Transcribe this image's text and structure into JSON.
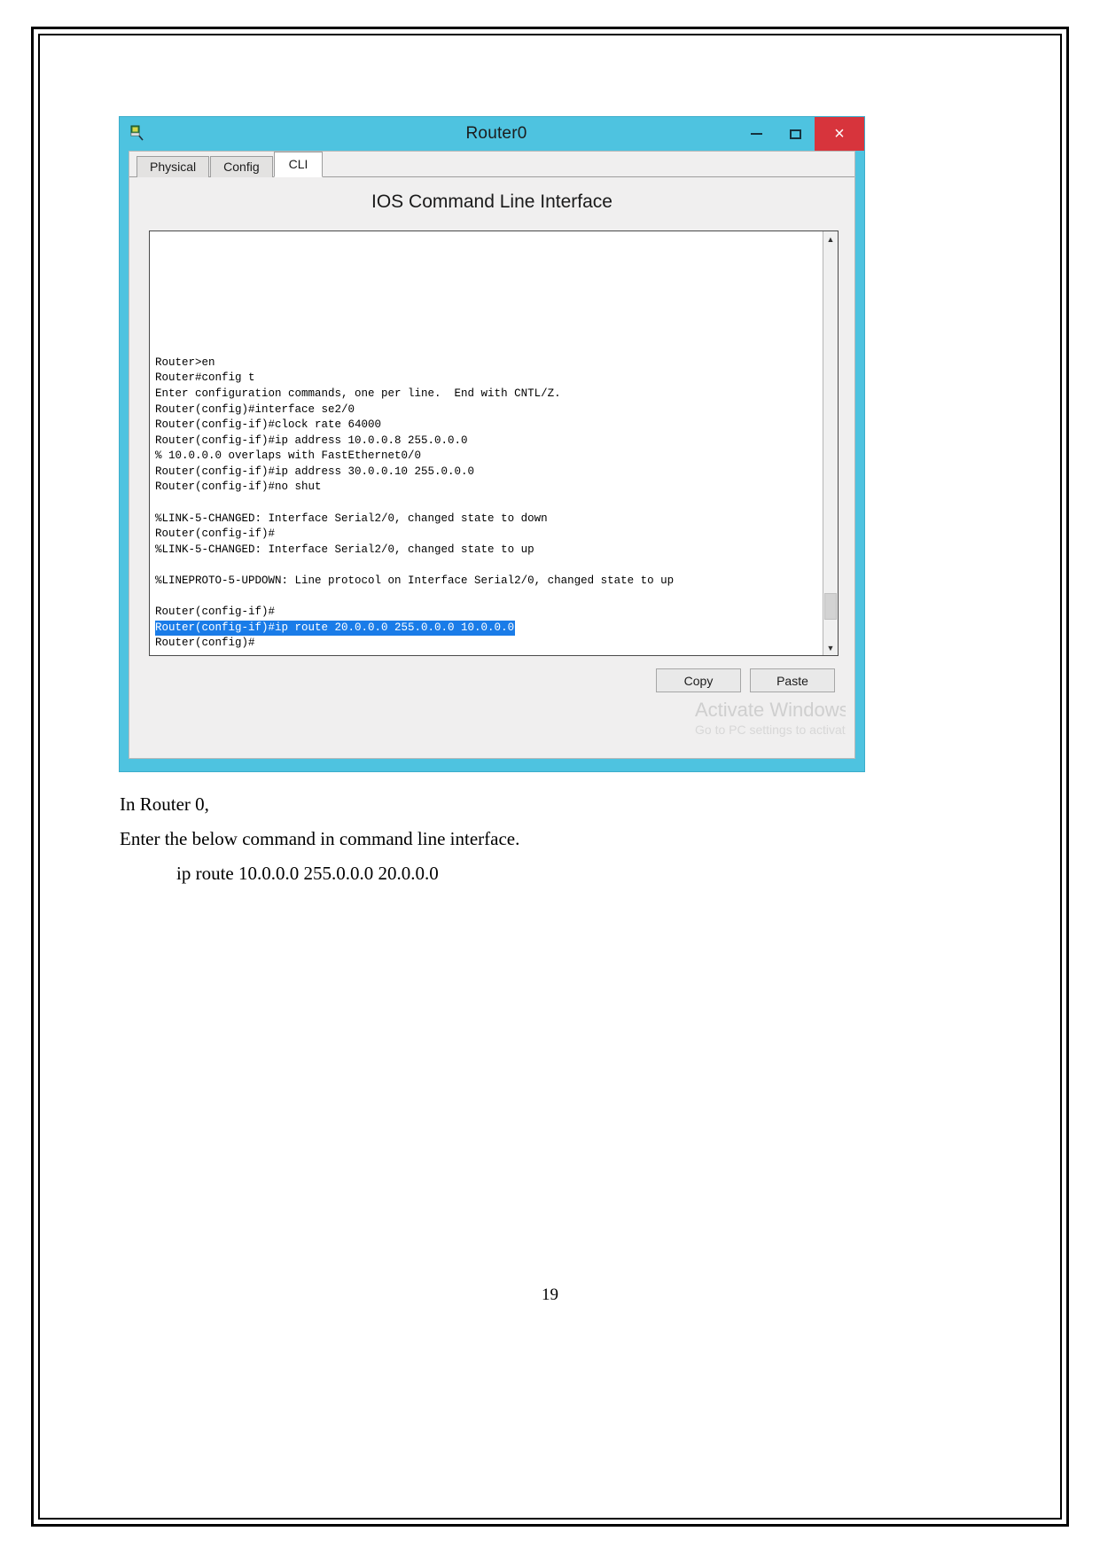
{
  "window": {
    "title": "Router0",
    "icon": "packet-tracer-router-icon",
    "controls": {
      "minimize": "–",
      "maximize": "☐",
      "close": "×"
    },
    "tabs": [
      {
        "label": "Physical",
        "active": false
      },
      {
        "label": "Config",
        "active": false
      },
      {
        "label": "CLI",
        "active": true
      }
    ],
    "panel_heading": "IOS Command Line Interface",
    "buttons": {
      "copy": "Copy",
      "paste": "Paste"
    },
    "scrollbar": {
      "up_arrow": "▲",
      "down_arrow": "▼"
    }
  },
  "terminal": {
    "lines": [
      {
        "text": "Router>en",
        "selected": false
      },
      {
        "text": "Router#config t",
        "selected": false
      },
      {
        "text": "Enter configuration commands, one per line.  End with CNTL/Z.",
        "selected": false
      },
      {
        "text": "Router(config)#interface se2/0",
        "selected": false
      },
      {
        "text": "Router(config-if)#clock rate 64000",
        "selected": false
      },
      {
        "text": "Router(config-if)#ip address 10.0.0.8 255.0.0.0",
        "selected": false
      },
      {
        "text": "% 10.0.0.0 overlaps with FastEthernet0/0",
        "selected": false
      },
      {
        "text": "Router(config-if)#ip address 30.0.0.10 255.0.0.0",
        "selected": false
      },
      {
        "text": "Router(config-if)#no shut",
        "selected": false
      },
      {
        "text": "",
        "selected": false
      },
      {
        "text": "%LINK-5-CHANGED: Interface Serial2/0, changed state to down",
        "selected": false
      },
      {
        "text": "Router(config-if)#",
        "selected": false
      },
      {
        "text": "%LINK-5-CHANGED: Interface Serial2/0, changed state to up",
        "selected": false
      },
      {
        "text": "",
        "selected": false
      },
      {
        "text": "%LINEPROTO-5-UPDOWN: Line protocol on Interface Serial2/0, changed state to up",
        "selected": false
      },
      {
        "text": "",
        "selected": false
      },
      {
        "text": "Router(config-if)#",
        "selected": false
      },
      {
        "text": "Router(config-if)#ip route 20.0.0.0 255.0.0.0 10.0.0.0",
        "selected": true
      },
      {
        "text": "Router(config)#",
        "selected": false
      }
    ]
  },
  "watermark": {
    "title": "Activate Windows",
    "subtitle": "Go to PC settings to activate Windows."
  },
  "document": {
    "lines": [
      {
        "text": "In Router 0,",
        "indent": false
      },
      {
        "text": "Enter the below command in command line interface.",
        "indent": false
      },
      {
        "text": "ip route 10.0.0.0 255.0.0.0 20.0.0.0",
        "indent": true
      }
    ],
    "page_number": "19"
  },
  "colors": {
    "titlebar": "#4ec3e0",
    "close_button": "#d7343c",
    "selection": "#1a7ce8",
    "panel": "#f0efef"
  }
}
